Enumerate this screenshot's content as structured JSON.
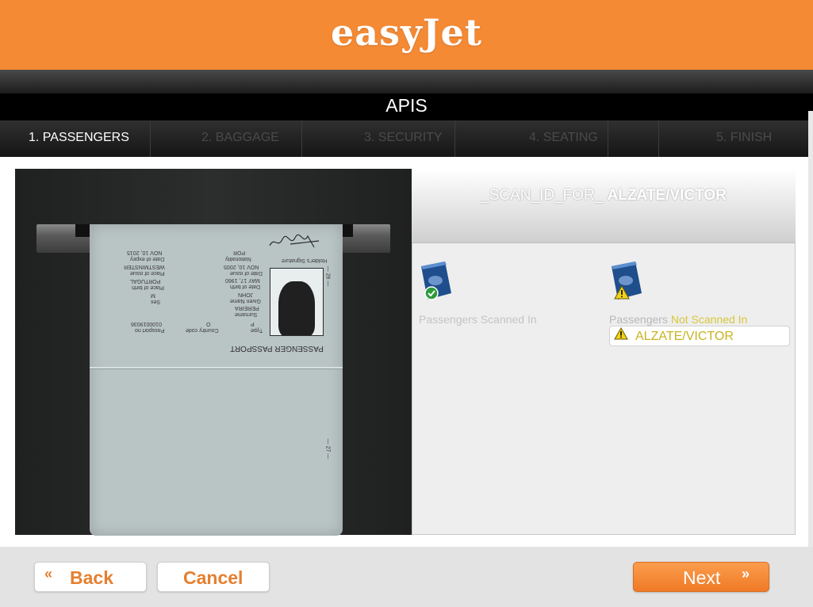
{
  "header": {
    "brand": "easyJet",
    "brand_color": "#f58a35"
  },
  "page": {
    "title": "APIS"
  },
  "steps": [
    {
      "label": "1. PASSENGERS",
      "active": true
    },
    {
      "label": "2. BAGGAGE",
      "active": false
    },
    {
      "label": "3. SECURITY",
      "active": false
    },
    {
      "label": "4. SEATING",
      "active": false
    },
    {
      "label": "",
      "active": false
    },
    {
      "label": "5. FINISH",
      "active": false
    }
  ],
  "scan_panel": {
    "title_prefix": "_SCAN_ID_FOR_",
    "passenger": "ALZATE/VICTOR",
    "scanned": {
      "label": "Passengers Scanned In",
      "icon": "passport-check-icon"
    },
    "not_scanned": {
      "label_prefix": "Passengers",
      "label_highlight": "Not Scanned In",
      "icon": "passport-warning-icon",
      "passengers": [
        "ALZATE/VICTOR"
      ]
    }
  },
  "passport_image": {
    "heading": "PASSENGER PASSPORT",
    "left_col": [
      "Type",
      "P",
      "Surname",
      "PEREIRA",
      "Given Name",
      "JOHN",
      "Date of birth",
      "MAY 17, 1960",
      "Date of issue",
      "NOV 10, 2005",
      "Nationality",
      "POR"
    ],
    "right_col": [
      "Country code",
      "O",
      "Passport no",
      "0100019036",
      "Sex",
      "M",
      "Place of birth",
      "PORTUGAL",
      "Place of issue",
      "WESTMINSTER",
      "Date of expiry",
      "NOV 10, 2015"
    ],
    "signature_label": "Holder's Signature",
    "page_top": "— 26 —",
    "page_bottom": "— 27 —"
  },
  "footer": {
    "back_label": "Back",
    "cancel_label": "Cancel",
    "next_label": "Next",
    "back_chevron": "«",
    "next_chevron": "»"
  }
}
